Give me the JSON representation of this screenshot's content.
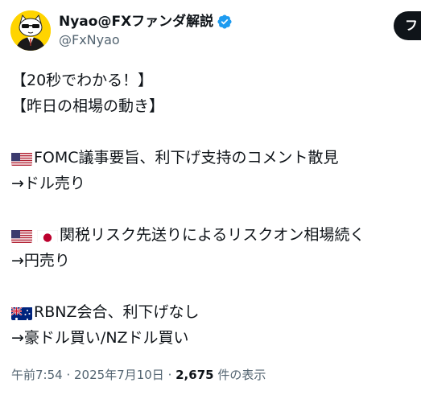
{
  "author": {
    "display_name": "Nyao@FXファンダ解説",
    "handle": "@FxNyao",
    "verified_icon": "verified-badge-icon",
    "avatar_icon": "cat-avatar-icon"
  },
  "follow_button": {
    "label": "フ"
  },
  "tweet": {
    "lines": [
      {
        "text": "【20秒でわかる！】"
      },
      {
        "text": "【昨日の相場の動き】"
      },
      {
        "text": ""
      },
      {
        "flags": [
          "us-flag-icon"
        ],
        "text": "FOMC議事要旨、利下げ支持のコメント散見"
      },
      {
        "text": "→ドル売り"
      },
      {
        "text": ""
      },
      {
        "flags": [
          "us-flag-icon",
          "jp-flag-icon"
        ],
        "text": "関税リスク先送りによるリスクオン相場続く"
      },
      {
        "text": "→円売り"
      },
      {
        "text": ""
      },
      {
        "flags": [
          "au-flag-icon"
        ],
        "text": "RBNZ会合、利下げなし"
      },
      {
        "text": "→豪ドル買い/NZドル買い"
      }
    ]
  },
  "meta": {
    "time": "午前7:54",
    "separator": " · ",
    "date": "2025年7月10日",
    "separator2": " · ",
    "views_count": "2,675",
    "views_label": " 件の表示"
  },
  "colors": {
    "text": "#0f1419",
    "secondary": "#536471",
    "verified": "#1d9bf0",
    "avatar_bg": "#ffd400"
  }
}
